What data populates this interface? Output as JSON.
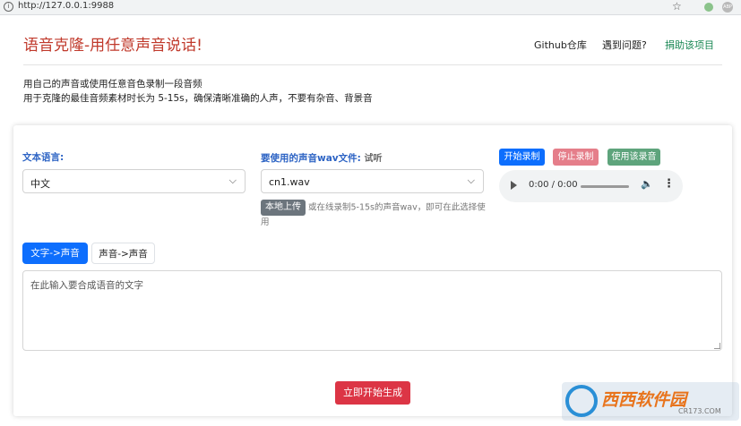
{
  "browser": {
    "url": "http://127.0.0.1:9988",
    "icons": [
      "info-icon",
      "bookmark-star-icon",
      "extension-icon",
      "adblock-icon"
    ],
    "adblock_label": "ABP"
  },
  "header": {
    "title": "语音克隆-用任意声音说话!",
    "nav": {
      "github": "Github仓库",
      "issues": "遇到问题?",
      "donate": "捐助该项目"
    },
    "title_color": "#c0392b"
  },
  "intro": {
    "line1": "用自己的声音或使用任意音色录制一段音频",
    "line2": "用于克隆的最佳音频素材时长为 5-15s，确保清晰准确的人声，不要有杂音、背景音"
  },
  "form": {
    "language_label": "文本语言:",
    "language_value": "中文",
    "wav_label": "要使用的声音wav文件:",
    "wav_hint": "试听",
    "wav_value": "cn1.wav",
    "upload_button": "本地上传",
    "upload_note": "或在线录制5-15s的声音wav，即可在此选择使用",
    "record": {
      "start": "开始录制",
      "stop": "停止录制",
      "use": "使用该录音"
    },
    "audio": {
      "time": "0:00 / 0:00"
    }
  },
  "tabs": [
    {
      "label": "文字->声音",
      "active": true
    },
    {
      "label": "声音->声音",
      "active": false
    }
  ],
  "textarea": {
    "placeholder": "在此输入要合成语音的文字"
  },
  "submit": {
    "label": "立即开始生成"
  },
  "watermark": {
    "brand": "西西软件园",
    "site": "CR173.COM"
  },
  "colors": {
    "primary": "#0d6efd",
    "danger": "#dc3545",
    "success": "#198754",
    "label_blue": "#2c63c4"
  }
}
